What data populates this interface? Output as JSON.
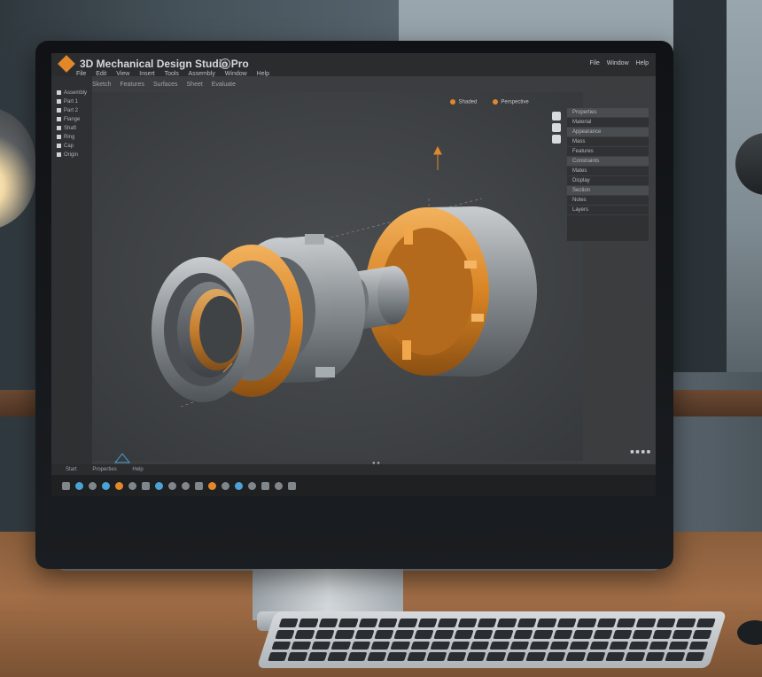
{
  "window": {
    "title": "3D Mechanical Design Studio Pro",
    "controls": [
      "File",
      "Window",
      "Help"
    ]
  },
  "menu": {
    "items": [
      "File",
      "Edit",
      "View",
      "Insert",
      "Tools",
      "Assembly",
      "Window",
      "Help"
    ],
    "sub_items": [
      "Sketch",
      "Features",
      "Surfaces",
      "Sheet",
      "Evaluate"
    ]
  },
  "left_panel": {
    "rows": [
      "Assembly",
      "Part 1",
      "Part 2",
      "Flange",
      "Shaft",
      "Ring",
      "Cap",
      "Origin"
    ]
  },
  "view_toolbar": {
    "labels": [
      "Shaded",
      "Perspective"
    ]
  },
  "right_panel": {
    "rows": [
      "Properties",
      "Material",
      "Appearance",
      "Mass",
      "Features",
      "Constraints",
      "Mates",
      "Display",
      "Section",
      "Notes",
      "Layers"
    ]
  },
  "status_bar": {
    "items": [
      "Start",
      "Properties",
      "Help"
    ]
  },
  "colors": {
    "accent": "#e2882a",
    "screen_bg": "#3b3d3f",
    "metal": "#8d9296"
  },
  "icons": [
    "logo-icon",
    "info-icon",
    "zoom-icon",
    "rotate-icon",
    "fit-icon",
    "axis-icon"
  ]
}
